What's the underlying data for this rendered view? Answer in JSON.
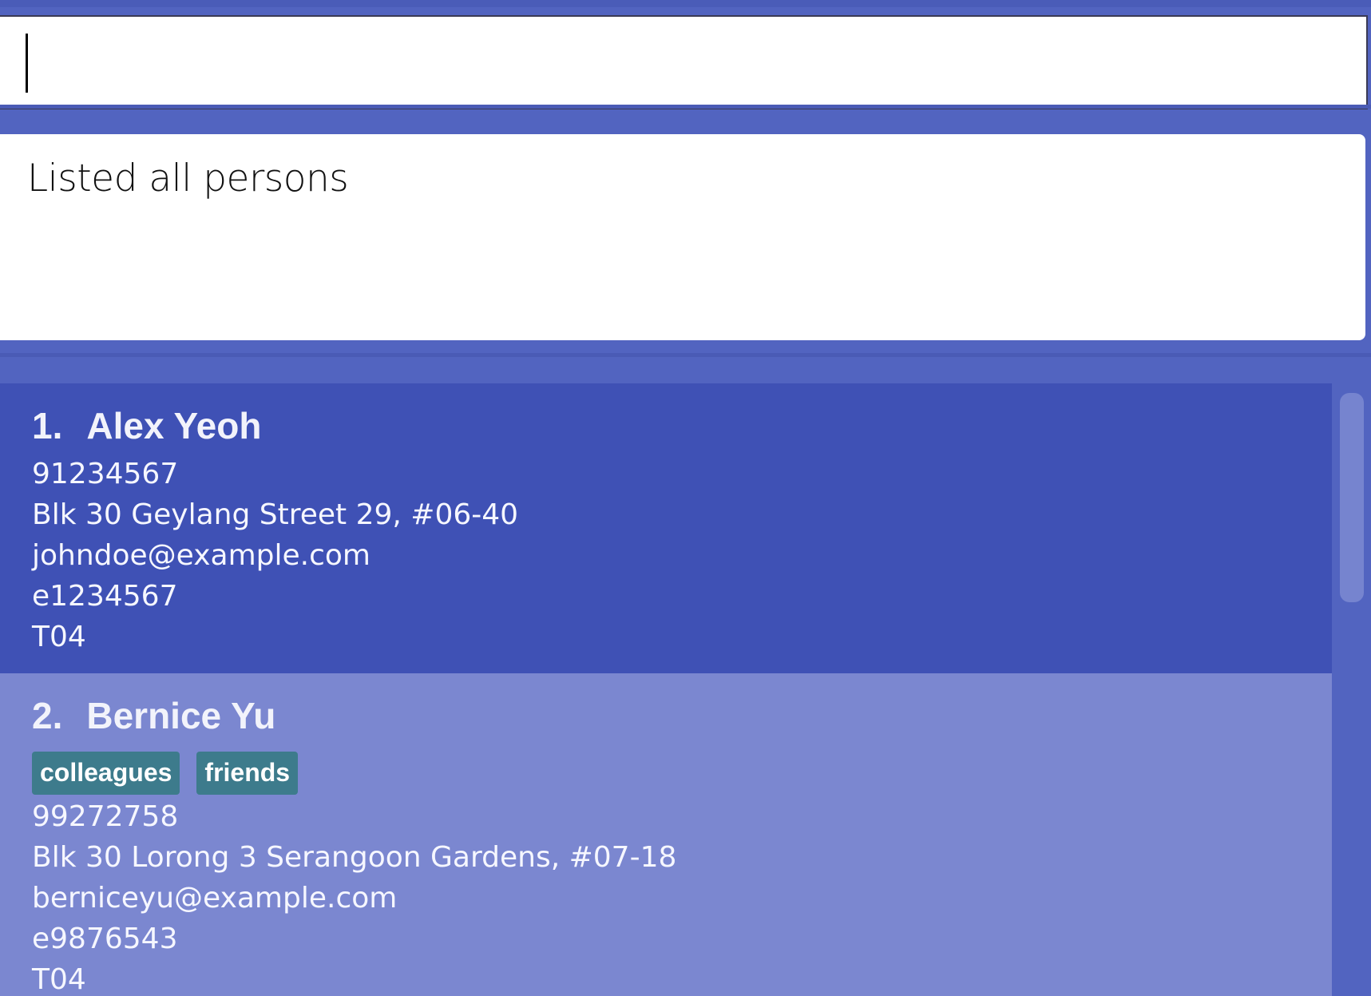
{
  "command": {
    "value": "",
    "placeholder": ""
  },
  "result": {
    "message": "Listed all persons"
  },
  "persons": [
    {
      "index": "1.",
      "name": "Alex Yeoh",
      "tags": [],
      "phone": "91234567",
      "address": "Blk 30 Geylang Street 29, #06-40",
      "email": "johndoe@example.com",
      "id": "e1234567",
      "tutorial": "T04",
      "selected": true
    },
    {
      "index": "2.",
      "name": "Bernice Yu",
      "tags": [
        "colleagues",
        "friends"
      ],
      "phone": "99272758",
      "address": "Blk 30 Lorong 3 Serangoon Gardens, #07-18",
      "email": "berniceyu@example.com",
      "id": "e9876543",
      "tutorial": "T04",
      "selected": false
    }
  ],
  "colors": {
    "background": "#5264c0",
    "selected_card": "#3f51b5",
    "card": "#7b87d0",
    "tag": "#3d7b8c"
  }
}
